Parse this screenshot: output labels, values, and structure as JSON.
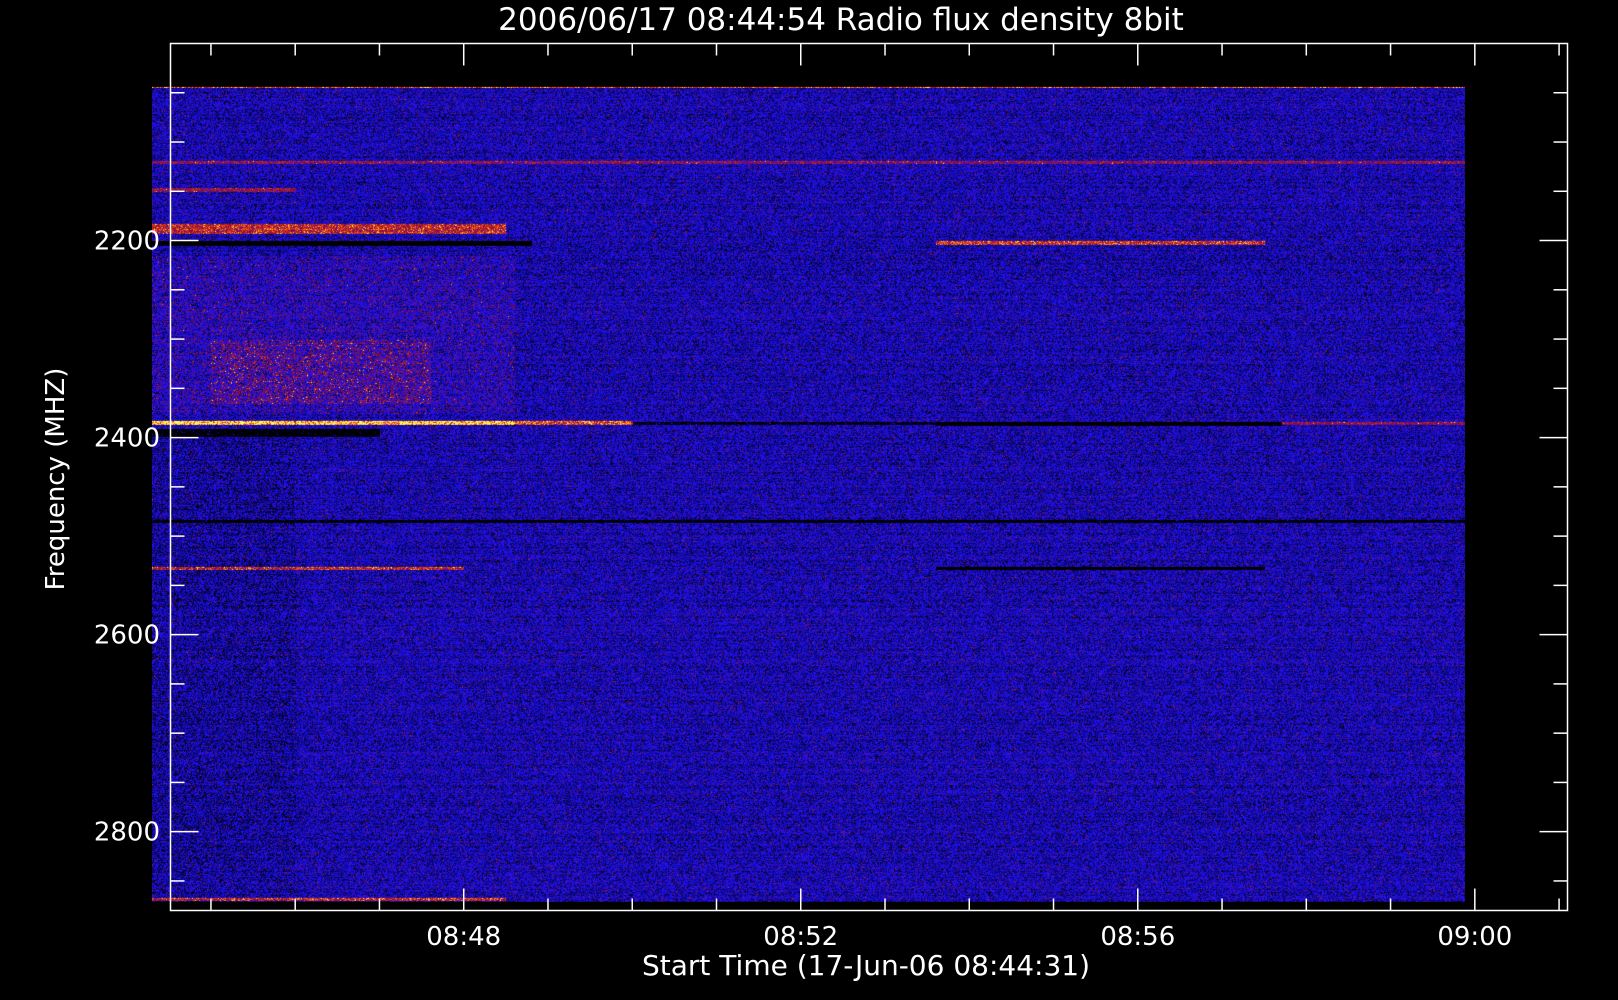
{
  "chart_data": {
    "type": "heatmap",
    "title": "2006/06/17 08:44:54 Radio flux density 8bit",
    "xlabel": "Start Time (17-Jun-06 08:44:31)",
    "ylabel": "Frequency (MHZ)",
    "x_ticks": [
      {
        "label": "08:48",
        "minutes": 48
      },
      {
        "label": "08:52",
        "minutes": 52
      },
      {
        "label": "08:56",
        "minutes": 56
      },
      {
        "label": "09:00",
        "minutes": 60
      }
    ],
    "x_minor_step_minutes": 1,
    "x_range_minutes": [
      44.52,
      61.1
    ],
    "data_time_range_minutes": [
      44.3,
      59.88
    ],
    "y_ticks": [
      2200,
      2400,
      2600,
      2800
    ],
    "y_minor_step": 50,
    "y_range_mhz": [
      2000,
      2880
    ],
    "data_freq_range_mhz": [
      2044,
      2871
    ],
    "y_inverted": true,
    "colormap": [
      "#000000",
      "#1a10ff",
      "#9c1020",
      "#ff5010",
      "#ffff60"
    ],
    "background_level": 0.22,
    "bands": [
      {
        "freq": 2384,
        "width": 4,
        "t0": 44.3,
        "t1": 48.6,
        "level": 0.95
      },
      {
        "freq": 2384,
        "width": 4,
        "t0": 48.6,
        "t1": 50.0,
        "level": 0.7
      },
      {
        "freq": 2385,
        "width": 4,
        "t0": 53.6,
        "t1": 57.7,
        "level": -0.8
      },
      {
        "freq": 2385,
        "width": 3,
        "t0": 50.0,
        "t1": 53.6,
        "level": -0.35
      },
      {
        "freq": 2385,
        "width": 3,
        "t0": 57.7,
        "t1": 59.88,
        "level": 0.45
      },
      {
        "freq": 2202,
        "width": 5,
        "t0": 44.3,
        "t1": 48.8,
        "level": -0.85
      },
      {
        "freq": 2202,
        "width": 4,
        "t0": 53.6,
        "t1": 57.5,
        "level": 0.65
      },
      {
        "freq": 2188,
        "width": 10,
        "t0": 44.3,
        "t1": 48.5,
        "level": 0.6
      },
      {
        "freq": 2532,
        "width": 3,
        "t0": 44.3,
        "t1": 48.0,
        "level": 0.6
      },
      {
        "freq": 2532,
        "width": 3,
        "t0": 53.6,
        "t1": 57.5,
        "level": -0.75
      },
      {
        "freq": 2484,
        "width": 3,
        "t0": 44.3,
        "t1": 59.88,
        "level": -0.5
      },
      {
        "freq": 2044,
        "width": 2,
        "t0": 44.3,
        "t1": 59.88,
        "level": 0.75
      },
      {
        "freq": 2868,
        "width": 3,
        "t0": 44.3,
        "t1": 48.5,
        "level": 0.6
      },
      {
        "freq": 2120,
        "width": 3,
        "t0": 44.3,
        "t1": 59.88,
        "level": 0.45
      },
      {
        "freq": 2148,
        "width": 4,
        "t0": 44.3,
        "t1": 46.0,
        "level": 0.45
      },
      {
        "freq": 2395,
        "width": 8,
        "t0": 44.3,
        "t1": 47.0,
        "level": -0.45
      }
    ],
    "patches": [
      {
        "t0": 44.3,
        "t1": 48.6,
        "f0": 2215,
        "f1": 2375,
        "level": 0.55
      },
      {
        "t0": 45.0,
        "t1": 47.6,
        "f0": 2300,
        "f1": 2365,
        "level": 0.85
      },
      {
        "t0": 44.3,
        "t1": 46.0,
        "f0": 2400,
        "f1": 2871,
        "level": -0.3
      }
    ]
  }
}
